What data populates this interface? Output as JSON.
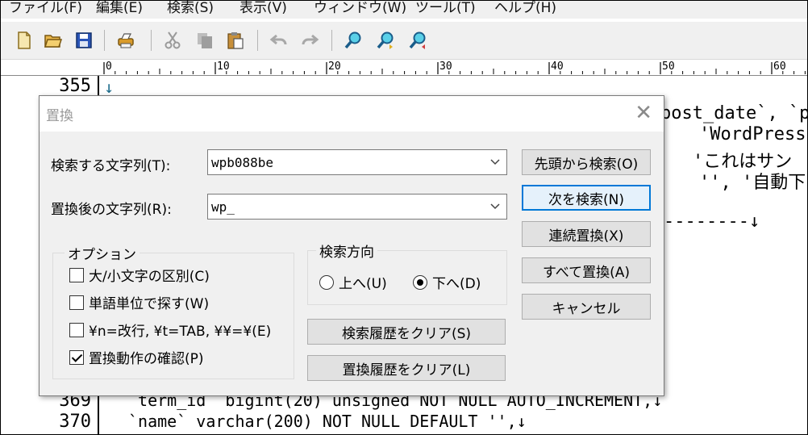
{
  "menu": [
    "ファイル(F)",
    "編集(E)",
    "検索(S)",
    "表示(V)",
    "ウィンドウ(W)",
    "ツール(T)",
    "ヘルプ(H)"
  ],
  "toolbar": {
    "icons": [
      "new-file-icon",
      "open-folder-icon",
      "save-icon",
      "print-icon",
      "cut-icon",
      "copy-icon",
      "paste-icon",
      "undo-icon",
      "redo-icon",
      "search-icon",
      "search-next-icon",
      "search-prev-icon"
    ]
  },
  "ruler": {
    "labels": [
      "0",
      "10",
      "20",
      "30",
      "40",
      "50",
      "60"
    ]
  },
  "editor": {
    "lines": [
      {
        "number": "355",
        "text": "↓"
      },
      {
        "number": "",
        "text": "post_date`, `p"
      },
      {
        "number": "",
        "text": "'WordPress"
      },
      {
        "number": "",
        "text": "'これはサン"
      },
      {
        "number": "",
        "text": "'', '自動下"
      },
      {
        "number": "",
        "text": "--------↓"
      },
      {
        "number": "369",
        "text": "`term_id` bigint(20) unsigned NOT NULL AUTO_INCREMENT,↓"
      },
      {
        "number": "370",
        "text": "`name` varchar(200) NOT NULL DEFAULT '',↓"
      }
    ]
  },
  "dialog": {
    "title": "置換",
    "find_label": "検索する文字列(T):",
    "find_value": "wpb088be",
    "replace_label": "置換後の文字列(R):",
    "replace_value": "wp_",
    "options": {
      "title": "オプション",
      "items": [
        {
          "label": "大/小文字の区別(C)",
          "checked": false
        },
        {
          "label": "単語単位で探す(W)",
          "checked": false
        },
        {
          "label": "¥n=改行, ¥t=TAB, ¥¥=¥(E)",
          "checked": false
        },
        {
          "label": "置換動作の確認(P)",
          "checked": true
        }
      ]
    },
    "direction": {
      "title": "検索方向",
      "up": "上へ(U)",
      "down": "下へ(D)",
      "selected": "down"
    },
    "buttons": {
      "search_from_top": "先頭から検索(O)",
      "find_next": "次を検索(N)",
      "continuous_replace": "連続置換(X)",
      "replace_all": "すべて置換(A)",
      "cancel": "キャンセル",
      "clear_search_history": "検索履歴をクリア(S)",
      "clear_replace_history": "置換履歴をクリア(L)"
    }
  }
}
